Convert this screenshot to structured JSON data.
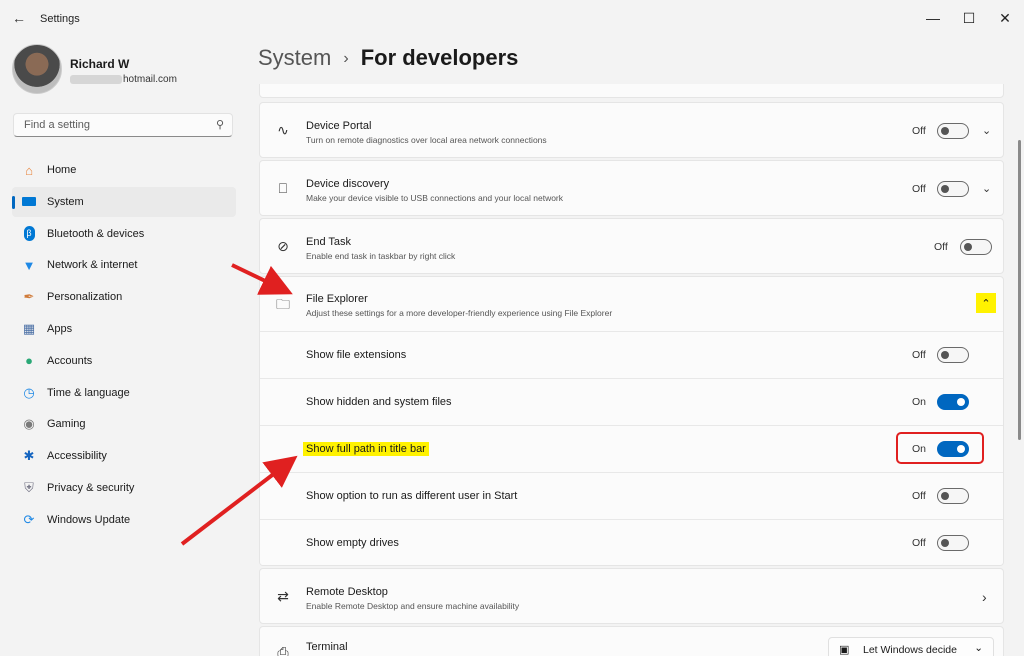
{
  "window": {
    "title": "Settings",
    "back_icon": "arrow-left-icon"
  },
  "profile": {
    "name": "Richard W",
    "email_suffix": "hotmail.com"
  },
  "search": {
    "placeholder": "Find a setting"
  },
  "nav": {
    "items": [
      {
        "label": "Home",
        "icon": "home-icon",
        "color": "#e8833a"
      },
      {
        "label": "System",
        "icon": "monitor-icon",
        "color": "#0078d4",
        "active": true
      },
      {
        "label": "Bluetooth & devices",
        "icon": "bluetooth-icon",
        "color": "#0078d4"
      },
      {
        "label": "Network & internet",
        "icon": "wifi-icon",
        "color": "#1e88e5"
      },
      {
        "label": "Personalization",
        "icon": "brush-icon",
        "color": "#d07b3a"
      },
      {
        "label": "Apps",
        "icon": "apps-icon",
        "color": "#4a6fa5"
      },
      {
        "label": "Accounts",
        "icon": "person-icon",
        "color": "#2aa876"
      },
      {
        "label": "Time & language",
        "icon": "globe-clock-icon",
        "color": "#1e88e5"
      },
      {
        "label": "Gaming",
        "icon": "controller-icon",
        "color": "#7a7a7a"
      },
      {
        "label": "Accessibility",
        "icon": "accessibility-icon",
        "color": "#1565c0"
      },
      {
        "label": "Privacy & security",
        "icon": "shield-icon",
        "color": "#7a7a8a"
      },
      {
        "label": "Windows Update",
        "icon": "refresh-icon",
        "color": "#1e88e5"
      }
    ]
  },
  "page": {
    "crumb": "System",
    "title": "For developers"
  },
  "settings": {
    "device_portal": {
      "title": "Device Portal",
      "subtitle": "Turn on remote diagnostics over local area network connections",
      "state": "Off"
    },
    "device_discovery": {
      "title": "Device discovery",
      "subtitle": "Make your device visible to USB connections and your local network",
      "state": "Off"
    },
    "end_task": {
      "title": "End Task",
      "subtitle": "Enable end task in taskbar by right click",
      "state": "Off"
    },
    "file_explorer": {
      "title": "File Explorer",
      "subtitle": "Adjust these settings for a more developer-friendly experience using File Explorer",
      "options": [
        {
          "label": "Show file extensions",
          "state": "Off"
        },
        {
          "label": "Show hidden and system files",
          "state": "On"
        },
        {
          "label": "Show full path in title bar",
          "state": "On"
        },
        {
          "label": "Show option to run as different user in Start",
          "state": "Off"
        },
        {
          "label": "Show empty drives",
          "state": "Off"
        }
      ]
    },
    "remote_desktop": {
      "title": "Remote Desktop",
      "subtitle": "Enable Remote Desktop and ensure machine availability"
    },
    "terminal": {
      "title": "Terminal",
      "dropdown_value": "Let Windows decide"
    }
  },
  "annotations": {
    "highlight_color": "#fff200",
    "arrow_color": "#e02020"
  }
}
